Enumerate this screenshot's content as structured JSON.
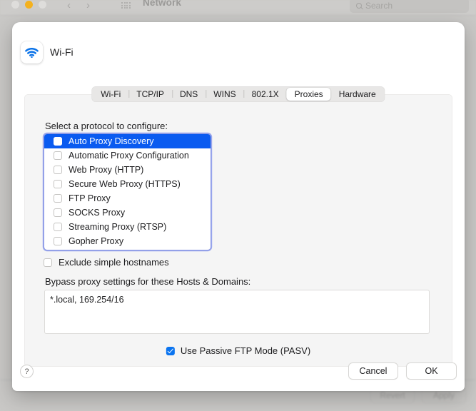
{
  "background_window": {
    "title": "Network",
    "search_placeholder": "Search",
    "search_icon": "search-icon",
    "back_icon": "chevron-left-icon",
    "forward_icon": "chevron-right-icon",
    "grid_icon": "grid-view-icon",
    "traffic_lights": [
      "close",
      "minimize",
      "zoom"
    ],
    "buttons": {
      "revert": "Revert",
      "apply": "Apply"
    }
  },
  "sheet": {
    "service_icon": "wifi-icon",
    "service_name": "Wi-Fi",
    "tabs": [
      {
        "label": "Wi-Fi",
        "active": false
      },
      {
        "label": "TCP/IP",
        "active": false
      },
      {
        "label": "DNS",
        "active": false
      },
      {
        "label": "WINS",
        "active": false
      },
      {
        "label": "802.1X",
        "active": false
      },
      {
        "label": "Proxies",
        "active": true
      },
      {
        "label": "Hardware",
        "active": false
      }
    ],
    "protocol_section_label": "Select a protocol to configure:",
    "protocols": [
      {
        "label": "Auto Proxy Discovery",
        "checked": false,
        "selected": true
      },
      {
        "label": "Automatic Proxy Configuration",
        "checked": false,
        "selected": false
      },
      {
        "label": "Web Proxy (HTTP)",
        "checked": false,
        "selected": false
      },
      {
        "label": "Secure Web Proxy (HTTPS)",
        "checked": false,
        "selected": false
      },
      {
        "label": "FTP Proxy",
        "checked": false,
        "selected": false
      },
      {
        "label": "SOCKS Proxy",
        "checked": false,
        "selected": false
      },
      {
        "label": "Streaming Proxy (RTSP)",
        "checked": false,
        "selected": false
      },
      {
        "label": "Gopher Proxy",
        "checked": false,
        "selected": false
      }
    ],
    "exclude_simple_hostnames": {
      "label": "Exclude simple hostnames",
      "checked": false
    },
    "bypass_label": "Bypass proxy settings for these Hosts & Domains:",
    "bypass_value": "*.local, 169.254/16",
    "passive_ftp": {
      "label": "Use Passive FTP Mode (PASV)",
      "checked": true
    },
    "help_glyph": "?",
    "buttons": {
      "cancel": "Cancel",
      "ok": "OK"
    }
  },
  "colors": {
    "selection_blue": "#0a5bf0",
    "checkbox_blue": "#0a74f0",
    "focus_ring": "#566ce8",
    "wifi_blue": "#0a72e8",
    "panel_bg": "#f5f5f5"
  }
}
